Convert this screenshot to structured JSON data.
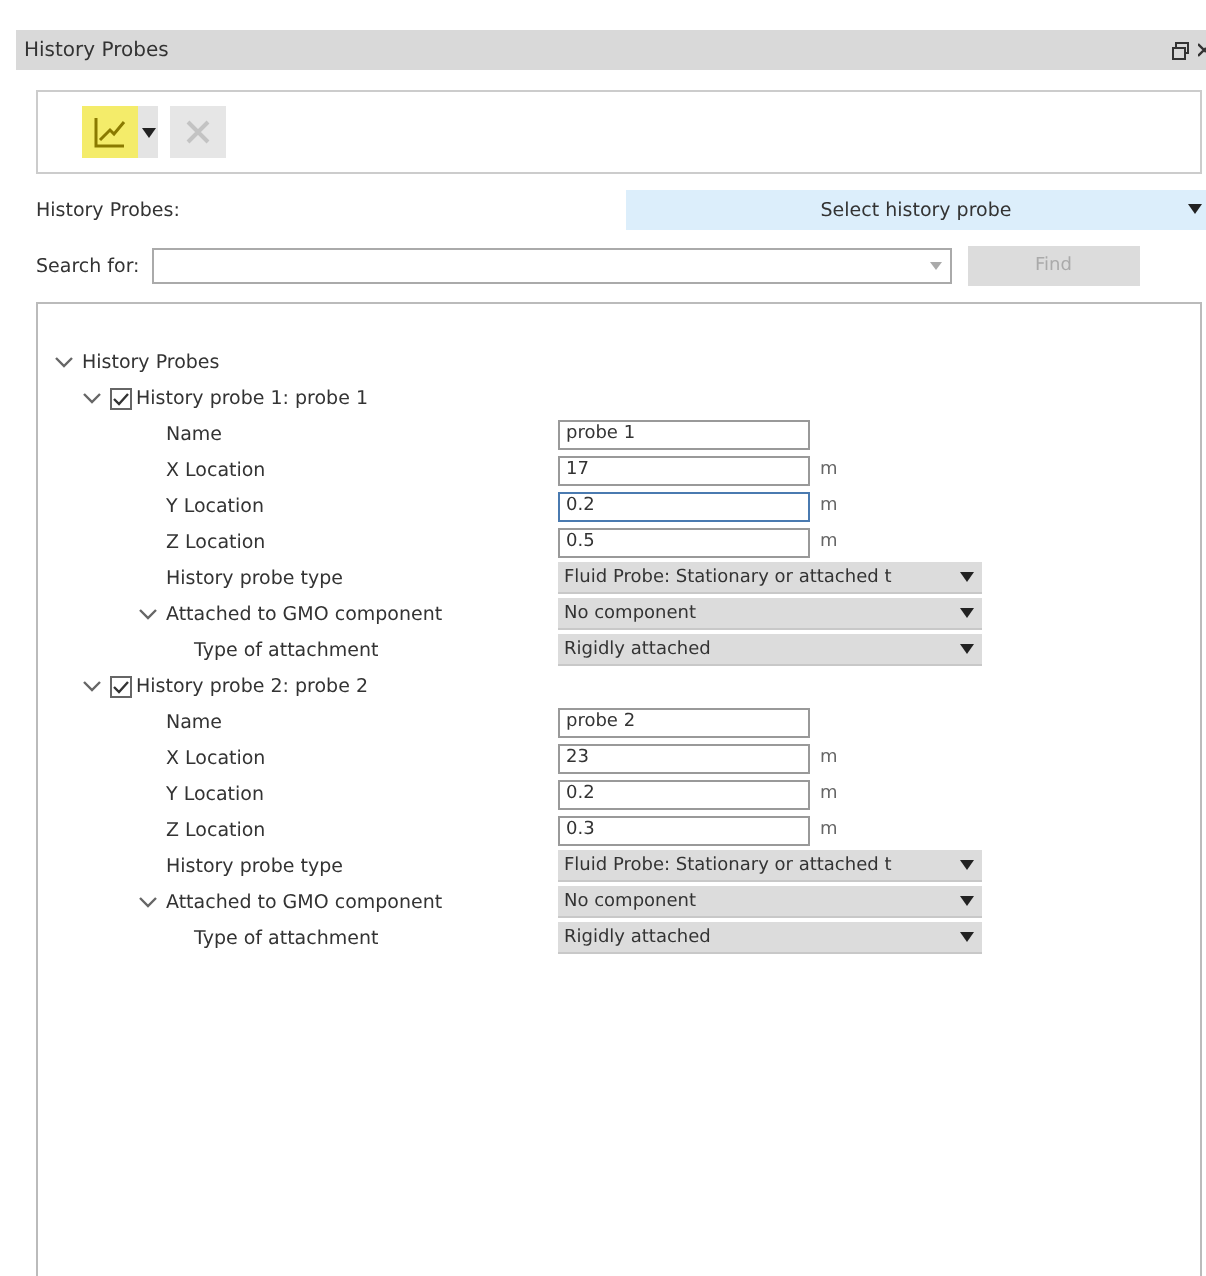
{
  "window": {
    "title": "History Probes"
  },
  "toolbar": {
    "buttons": [
      {
        "kind": "add",
        "disabled": false,
        "has_menu": true
      },
      {
        "kind": "delete",
        "disabled": true,
        "has_menu": false
      }
    ]
  },
  "probe_selector": {
    "label": "History Probes:",
    "value": "Select history probe"
  },
  "search": {
    "label": "Search for:",
    "button": "Find",
    "button_disabled": true
  },
  "tree": {
    "label": "History Probes",
    "expanded": true,
    "children": [
      {
        "label": "History probe 1: probe 1",
        "checked": true,
        "expanded": true,
        "properties": [
          {
            "label": "Name",
            "kind": "text",
            "value": "probe 1",
            "focused": false
          },
          {
            "label": "X Location",
            "kind": "text",
            "value": "17",
            "unit": "m",
            "focused": false
          },
          {
            "label": "Y Location",
            "kind": "text",
            "value": "0.2",
            "unit": "m",
            "focused": true
          },
          {
            "label": "Z Location",
            "kind": "text",
            "value": "0.5",
            "unit": "m",
            "focused": false
          },
          {
            "label": "History probe type",
            "kind": "select",
            "value": "Fluid Probe: Stationary or attached t"
          },
          {
            "label": "Attached to GMO component",
            "kind": "select",
            "value": "No component",
            "expanded": true,
            "children": [
              {
                "label": "Type of attachment",
                "kind": "select",
                "value": "Rigidly attached"
              }
            ]
          }
        ]
      },
      {
        "label": "History probe 2: probe 2",
        "checked": true,
        "expanded": true,
        "properties": [
          {
            "label": "Name",
            "kind": "text",
            "value": "probe 2",
            "focused": false
          },
          {
            "label": "X Location",
            "kind": "text",
            "value": "23",
            "unit": "m",
            "focused": false
          },
          {
            "label": "Y Location",
            "kind": "text",
            "value": "0.2",
            "unit": "m",
            "focused": false
          },
          {
            "label": "Z Location",
            "kind": "text",
            "value": "0.3",
            "unit": "m",
            "focused": false
          },
          {
            "label": "History probe type",
            "kind": "select",
            "value": "Fluid Probe: Stationary or attached t"
          },
          {
            "label": "Attached to GMO component",
            "kind": "select",
            "value": "No component",
            "expanded": true,
            "children": [
              {
                "label": "Type of attachment",
                "kind": "select",
                "value": "Rigidly attached"
              }
            ]
          }
        ]
      }
    ]
  }
}
